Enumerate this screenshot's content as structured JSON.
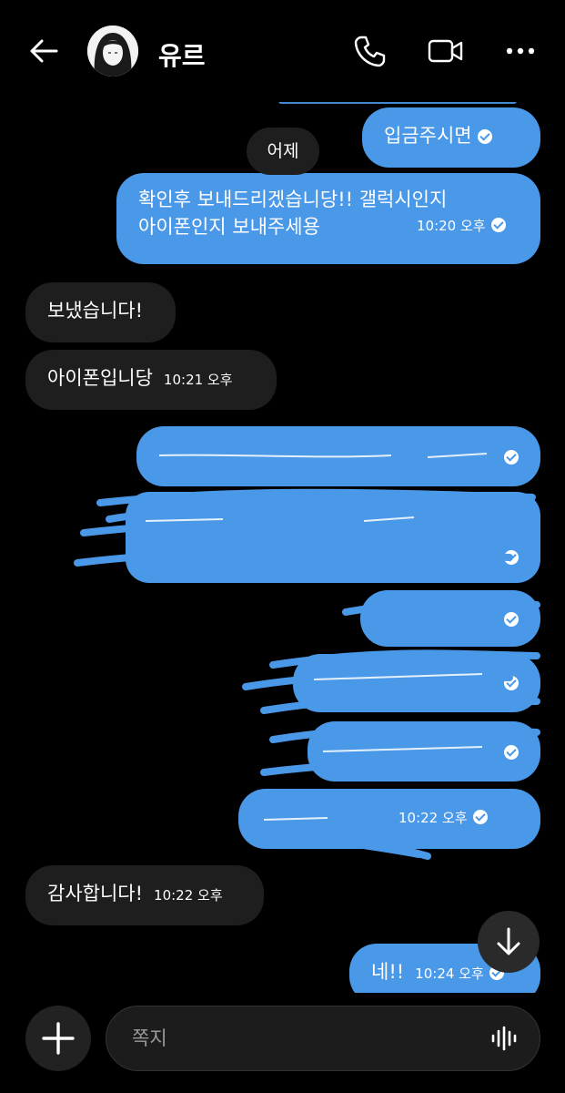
{
  "header": {
    "contact_name": "유르"
  },
  "date_separator": "어제",
  "messages": [
    {
      "direction": "outgoing",
      "text": "입금주시면",
      "time": "",
      "read": true
    },
    {
      "direction": "outgoing",
      "text_line1": "확인후 보내드리겠습니당!! 갤럭시인지",
      "text_line2": "아이폰인지 보내주세용",
      "time": "10:20 오후",
      "read": true
    },
    {
      "direction": "incoming",
      "text": "보냈습니다!",
      "time": ""
    },
    {
      "direction": "incoming",
      "text": "아이폰입니당",
      "time": "10:21 오후"
    },
    {
      "direction": "outgoing",
      "redacted": true,
      "read": true
    },
    {
      "direction": "outgoing",
      "redacted": true,
      "read": true
    },
    {
      "direction": "outgoing",
      "redacted": true,
      "read": true
    },
    {
      "direction": "outgoing",
      "redacted": true,
      "read": true
    },
    {
      "direction": "outgoing",
      "redacted": true,
      "read": true
    },
    {
      "direction": "outgoing",
      "redacted": true,
      "time": "10:22 오후",
      "read": true
    },
    {
      "direction": "incoming",
      "text": "감사합니다!",
      "time": "10:22 오후"
    },
    {
      "direction": "outgoing",
      "text": "네!!",
      "time": "10:24 오후",
      "read": true
    }
  ],
  "composer": {
    "placeholder": "쪽지"
  },
  "colors": {
    "outgoing_bubble": "#4a98e8",
    "incoming_bubble": "#1e1e1e",
    "background": "#000000"
  },
  "icons": [
    "back-arrow-icon",
    "phone-icon",
    "video-camera-icon",
    "more-dots-icon",
    "check-circle-icon",
    "arrow-down-icon",
    "plus-icon",
    "voice-wave-icon"
  ]
}
